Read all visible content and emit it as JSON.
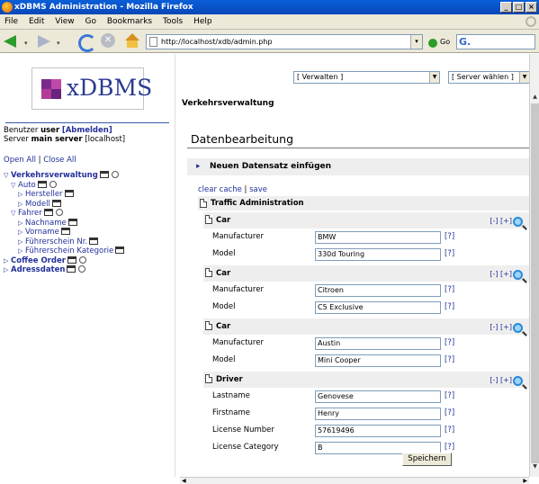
{
  "window": {
    "title": "xDBMS Administration - Mozilla Firefox"
  },
  "menubar": [
    "File",
    "Edit",
    "View",
    "Go",
    "Bookmarks",
    "Tools",
    "Help"
  ],
  "navbar": {
    "url": "http://localhost/xdb/admin.php",
    "go_label": "Go",
    "search_placeholder": ""
  },
  "sidebar": {
    "logo_text": "xDBMS",
    "user_label": "Benutzer",
    "user_name": "user",
    "logout_link": "[Abmelden]",
    "server_label": "Server",
    "server_name": "main server",
    "server_host": "[localhost]",
    "open_all": "Open All",
    "close_all": "Close All",
    "tree": [
      {
        "label": "Verkehrsverwaltung",
        "level": 0,
        "bold": true,
        "expanded": true,
        "icons": true
      },
      {
        "label": "Auto",
        "level": 1,
        "bold": false,
        "expanded": true,
        "icons": true
      },
      {
        "label": "Hersteller",
        "level": 2,
        "bold": false,
        "expanded": false,
        "icons": "table"
      },
      {
        "label": "Modell",
        "level": 2,
        "bold": false,
        "expanded": false,
        "icons": "table"
      },
      {
        "label": "Fahrer",
        "level": 1,
        "bold": false,
        "expanded": true,
        "icons": true
      },
      {
        "label": "Nachname",
        "level": 2,
        "bold": false,
        "expanded": false,
        "icons": "table"
      },
      {
        "label": "Vorname",
        "level": 2,
        "bold": false,
        "expanded": false,
        "icons": "table"
      },
      {
        "label": "Führerschein Nr.",
        "level": 2,
        "bold": false,
        "expanded": false,
        "icons": "table"
      },
      {
        "label": "Führerschein Kategorie",
        "level": 2,
        "bold": false,
        "expanded": false,
        "icons": "table"
      },
      {
        "label": "Coffee Order",
        "level": 0,
        "bold": true,
        "expanded": false,
        "icons": true
      },
      {
        "label": "Adressdaten",
        "level": 0,
        "bold": true,
        "expanded": false,
        "icons": true
      }
    ]
  },
  "main": {
    "select_manage": "[ Verwalten ]",
    "select_server": "[ Server wählen ]",
    "section_title": "Verkehrsverwaltung",
    "page_title": "Datenbearbeitung",
    "insert_label": "Neuen Datensatz einfügen",
    "clear_cache": "clear cache",
    "save_link": "save",
    "root_label": "Traffic Administration",
    "record_controls": {
      "collapse": "[-]",
      "expand": "[+]"
    },
    "help_label": "[?]",
    "save_button": "Speichern",
    "records": [
      {
        "type": "Car",
        "fields": [
          {
            "label": "Manufacturer",
            "value": "BMW"
          },
          {
            "label": "Model",
            "value": "330d Touring"
          }
        ]
      },
      {
        "type": "Car",
        "fields": [
          {
            "label": "Manufacturer",
            "value": "Citroen"
          },
          {
            "label": "Model",
            "value": "C5 Exclusive"
          }
        ]
      },
      {
        "type": "Car",
        "fields": [
          {
            "label": "Manufacturer",
            "value": "Austin"
          },
          {
            "label": "Model",
            "value": "Mini Cooper"
          }
        ]
      },
      {
        "type": "Driver",
        "fields": [
          {
            "label": "Lastname",
            "value": "Genovese"
          },
          {
            "label": "Firstname",
            "value": "Henry"
          },
          {
            "label": "License Number",
            "value": "57619496"
          },
          {
            "label": "License Category",
            "value": "B"
          }
        ]
      }
    ]
  }
}
